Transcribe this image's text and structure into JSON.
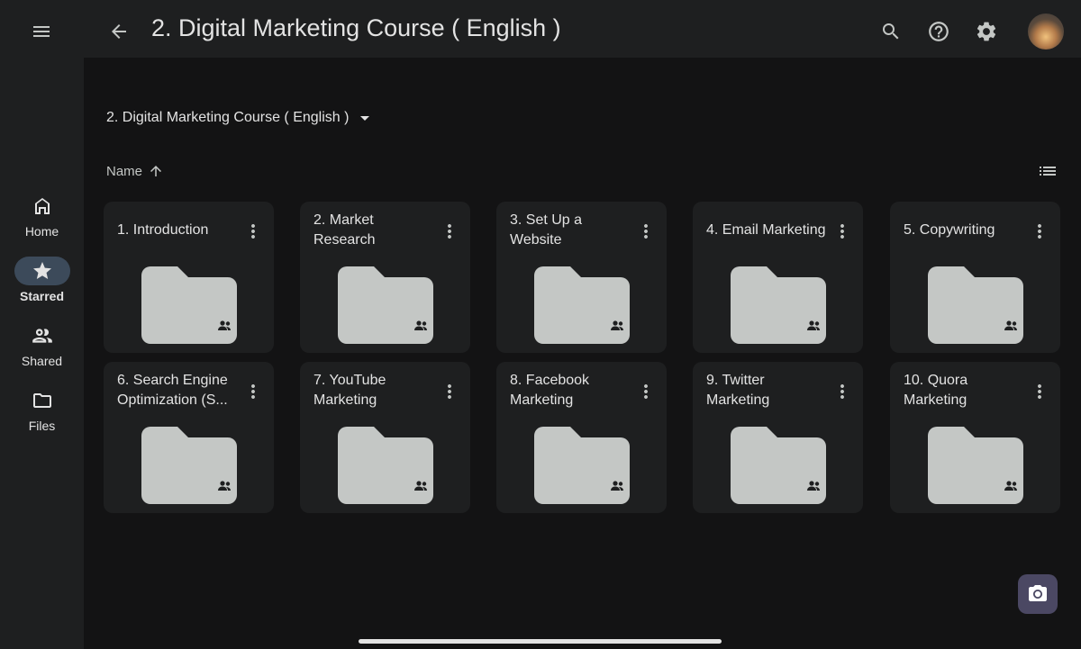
{
  "header": {
    "title": "2. Digital Marketing Course ( English )",
    "icons": [
      "menu-icon",
      "back-arrow-icon",
      "search-icon",
      "help-icon",
      "settings-icon"
    ]
  },
  "sidebar": {
    "items": [
      {
        "label": "Home",
        "icon": "home-icon",
        "active": false
      },
      {
        "label": "Starred",
        "icon": "star-icon",
        "active": true
      },
      {
        "label": "Shared",
        "icon": "people-icon",
        "active": false
      },
      {
        "label": "Files",
        "icon": "folder-icon",
        "active": false
      }
    ]
  },
  "main": {
    "breadcrumb": "2. Digital Marketing Course ( English )",
    "sort_label": "Name",
    "folders": [
      {
        "name": "1. Introduction"
      },
      {
        "name": "2. Market Research"
      },
      {
        "name": "3. Set Up a Website"
      },
      {
        "name": "4. Email Marketing"
      },
      {
        "name": "5. Copywriting"
      },
      {
        "name": "6. Search Engine Optimization (S..."
      },
      {
        "name": "7. YouTube Marketing"
      },
      {
        "name": "8. Facebook Marketing"
      },
      {
        "name": "9. Twitter Marketing"
      },
      {
        "name": "10. Quora Marketing"
      }
    ]
  },
  "colors": {
    "background": "#131314",
    "surface": "#1e1f20",
    "folder": "#c4c7c5",
    "active_pill": "#3c4a5a",
    "fab": "#4b4863"
  }
}
